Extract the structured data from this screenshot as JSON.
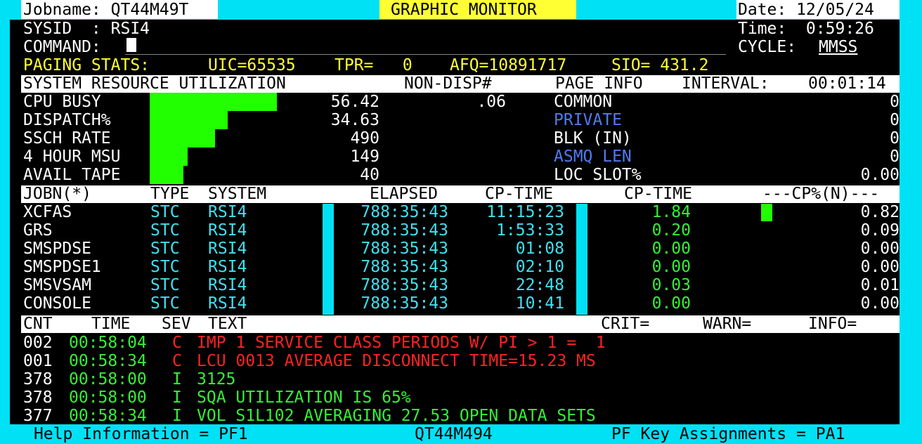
{
  "top": {
    "jobname": "Jobname: QT44M49T",
    "title": "GRAPHIC MONITOR",
    "date": "Date: 12/05/24",
    "sysid": "SYSID  : RSI4",
    "time": "Time:  0:59:26",
    "command_label": "COMMAND:",
    "cycle_label": "CYCLE:",
    "cycle_value": "MMSS"
  },
  "paging": {
    "label": "PAGING STATS:",
    "uic": "UIC=65535",
    "tpr": "TPR=   0",
    "afq": "AFQ=10891717",
    "sio": "SIO= 431.2"
  },
  "resource_header": {
    "title": "SYSTEM RESOURCE UTILIZATION",
    "nondisp": "NON-DISP#",
    "pageinfo": "PAGE INFO",
    "interval_label": "INTERVAL:",
    "interval_value": "00:01:14"
  },
  "resources": [
    {
      "label": "CPU BUSY",
      "value": "56.42",
      "nondisp": ".06",
      "bar": 0.5642
    },
    {
      "label": "DISPATCH%",
      "value": "34.63",
      "nondisp": "",
      "bar": 0.3463
    },
    {
      "label": "SSCH RATE",
      "value": "490",
      "nondisp": "",
      "bar": 0.29
    },
    {
      "label": "4 HOUR MSU",
      "value": "149",
      "nondisp": "",
      "bar": 0.17
    },
    {
      "label": "AVAIL TAPE",
      "value": "40",
      "nondisp": "",
      "bar": 0.15
    }
  ],
  "pageinfo": [
    {
      "label": "COMMON",
      "value": "0",
      "color": "#ffffff"
    },
    {
      "label": "PRIVATE",
      "value": "0",
      "color": "#4f7bf2"
    },
    {
      "label": "BLK (IN)",
      "value": "0",
      "color": "#ffffff"
    },
    {
      "label": "ASMQ LEN",
      "value": "0",
      "color": "#4f7bf2"
    },
    {
      "label": "LOC SLOT%",
      "value": "0.00",
      "color": "#ffffff"
    }
  ],
  "job_header": {
    "jobn": "JOBN(*)",
    "type": "TYPE",
    "system": "SYSTEM",
    "elapsed": "ELAPSED",
    "cptime": "CP-TIME",
    "cptime2": "CP-TIME",
    "cpn": "---CP%(N)---"
  },
  "jobs": [
    {
      "name": "XCFAS",
      "type": "STC",
      "system": "RSI4",
      "elapsed": "788:35:43",
      "cptime": "11:15:23",
      "cpt": "1.84",
      "cpn": "0.82",
      "bar": 0.82
    },
    {
      "name": "GRS",
      "type": "STC",
      "system": "RSI4",
      "elapsed": "788:35:43",
      "cptime": "1:53:33",
      "cpt": "0.20",
      "cpn": "0.09",
      "bar": 0
    },
    {
      "name": "SMSPDSE",
      "type": "STC",
      "system": "RSI4",
      "elapsed": "788:35:43",
      "cptime": "01:08",
      "cpt": "0.00",
      "cpn": "0.00",
      "bar": 0
    },
    {
      "name": "SMSPDSE1",
      "type": "STC",
      "system": "RSI4",
      "elapsed": "788:35:43",
      "cptime": "02:10",
      "cpt": "0.00",
      "cpn": "0.00",
      "bar": 0
    },
    {
      "name": "SMSVSAM",
      "type": "STC",
      "system": "RSI4",
      "elapsed": "788:35:43",
      "cptime": "22:48",
      "cpt": "0.03",
      "cpn": "0.01",
      "bar": 0
    },
    {
      "name": "CONSOLE",
      "type": "STC",
      "system": "RSI4",
      "elapsed": "788:35:43",
      "cptime": "10:41",
      "cpt": "0.00",
      "cpn": "0.00",
      "bar": 0
    }
  ],
  "msg_header": {
    "cnt": "CNT",
    "time": "TIME",
    "sev": "SEV",
    "text": "TEXT",
    "crit": "CRIT=",
    "warn": "WARN=",
    "info": "INFO="
  },
  "messages": [
    {
      "cnt": "002",
      "time": "00:58:04",
      "sev": "C",
      "text": "IMP 1 SERVICE CLASS PERIODS W/ PI > 1 =  1",
      "color": "#ff2222"
    },
    {
      "cnt": "001",
      "time": "00:58:34",
      "sev": "C",
      "text": "LCU 0013 AVERAGE DISCONNECT TIME=15.23 MS",
      "color": "#ff2222"
    },
    {
      "cnt": "378",
      "time": "00:58:00",
      "sev": "I",
      "text": "3125",
      "color": "#35f035"
    },
    {
      "cnt": "378",
      "time": "00:58:00",
      "sev": "I",
      "text": "SQA UTILIZATION IS 65%",
      "color": "#35f035"
    },
    {
      "cnt": "377",
      "time": "00:58:34",
      "sev": "I",
      "text": "VOL S1L102 AVERAGING 27.53 OPEN DATA SETS",
      "color": "#35f035"
    }
  ],
  "footer": {
    "help": "Help Information = PF1",
    "job": "QT44M494",
    "pfkeys": "PF Key Assignments = PA1"
  },
  "colors": {
    "frame": "#00e1f5",
    "bar": "#22ff00",
    "title_bg": "#ffff33"
  }
}
